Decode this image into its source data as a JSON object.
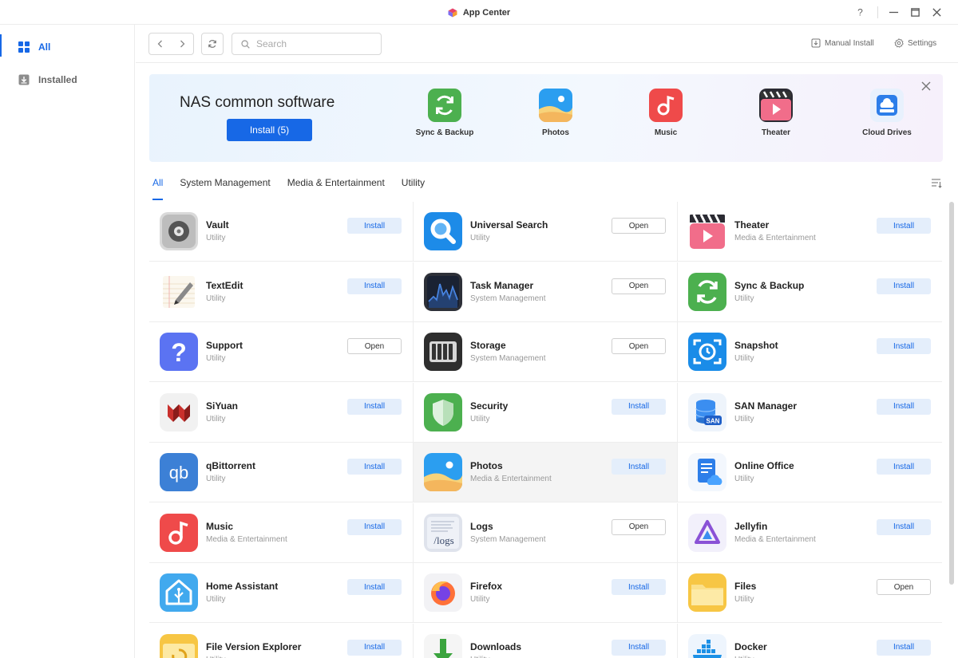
{
  "window": {
    "title": "App Center"
  },
  "sidebar": {
    "items": [
      {
        "label": "All",
        "icon": "grid-icon"
      },
      {
        "label": "Installed",
        "icon": "download-icon"
      }
    ]
  },
  "toolbar": {
    "search_placeholder": "Search",
    "manual_install_label": "Manual Install",
    "settings_label": "Settings"
  },
  "banner": {
    "title": "NAS common software",
    "install_label": "Install (5)",
    "apps": [
      {
        "label": "Sync & Backup",
        "icon": "sync"
      },
      {
        "label": "Photos",
        "icon": "photos"
      },
      {
        "label": "Music",
        "icon": "music"
      },
      {
        "label": "Theater",
        "icon": "theater"
      },
      {
        "label": "Cloud Drives",
        "icon": "cloud"
      }
    ]
  },
  "tabs": [
    "All",
    "System Management",
    "Media & Entertainment",
    "Utility"
  ],
  "apps": [
    {
      "name": "Vault",
      "category": "Utility",
      "action": "Install",
      "icon": "vault"
    },
    {
      "name": "Universal Search",
      "category": "Utility",
      "action": "Open",
      "icon": "search"
    },
    {
      "name": "Theater",
      "category": "Media & Entertainment",
      "action": "Install",
      "icon": "theater"
    },
    {
      "name": "TextEdit",
      "category": "Utility",
      "action": "Install",
      "icon": "textedit"
    },
    {
      "name": "Task Manager",
      "category": "System Management",
      "action": "Open",
      "icon": "taskmgr"
    },
    {
      "name": "Sync & Backup",
      "category": "Utility",
      "action": "Install",
      "icon": "sync"
    },
    {
      "name": "Support",
      "category": "Utility",
      "action": "Open",
      "icon": "support"
    },
    {
      "name": "Storage",
      "category": "System Management",
      "action": "Open",
      "icon": "storage"
    },
    {
      "name": "Snapshot",
      "category": "Utility",
      "action": "Install",
      "icon": "snapshot"
    },
    {
      "name": "SiYuan",
      "category": "Utility",
      "action": "Install",
      "icon": "siyuan"
    },
    {
      "name": "Security",
      "category": "Utility",
      "action": "Install",
      "icon": "security"
    },
    {
      "name": "SAN Manager",
      "category": "Utility",
      "action": "Install",
      "icon": "san"
    },
    {
      "name": "qBittorrent",
      "category": "Utility",
      "action": "Install",
      "icon": "qbit"
    },
    {
      "name": "Photos",
      "category": "Media & Entertainment",
      "action": "Install",
      "icon": "photos"
    },
    {
      "name": "Online Office",
      "category": "Utility",
      "action": "Install",
      "icon": "office"
    },
    {
      "name": "Music",
      "category": "Media & Entertainment",
      "action": "Install",
      "icon": "music"
    },
    {
      "name": "Logs",
      "category": "System Management",
      "action": "Open",
      "icon": "logs"
    },
    {
      "name": "Jellyfin",
      "category": "Media & Entertainment",
      "action": "Install",
      "icon": "jellyfin"
    },
    {
      "name": "Home Assistant",
      "category": "Utility",
      "action": "Install",
      "icon": "homeassistant"
    },
    {
      "name": "Firefox",
      "category": "Utility",
      "action": "Install",
      "icon": "firefox"
    },
    {
      "name": "Files",
      "category": "Utility",
      "action": "Open",
      "icon": "files"
    },
    {
      "name": "File Version Explorer",
      "category": "Utility",
      "action": "Install",
      "icon": "fileversion"
    },
    {
      "name": "Downloads",
      "category": "Utility",
      "action": "Install",
      "icon": "downloads"
    },
    {
      "name": "Docker",
      "category": "Utility",
      "action": "Install",
      "icon": "docker"
    }
  ],
  "colors": {
    "accent": "#1768e6",
    "install_bg": "#e4eefb"
  }
}
